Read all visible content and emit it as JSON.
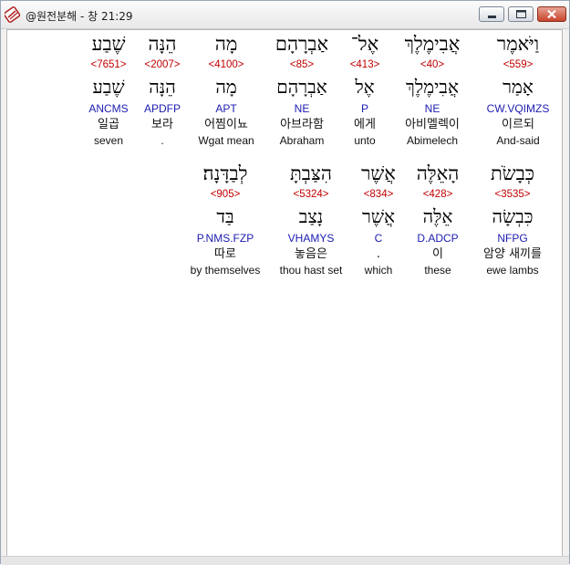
{
  "window": {
    "title": "@원전분해 - 창 21:29"
  },
  "verse": {
    "line1": [
      {
        "hebrew": "וַיֹּאמֶר",
        "strong": "<559>",
        "lemma": "אָמַר",
        "morph": "CW.VQIMZS",
        "korean": "이르되",
        "english": "And-said"
      },
      {
        "hebrew": "אֲבִימֶלֶךְ",
        "strong": "<40>",
        "lemma": "אֲבִימֶלֶךְ",
        "morph": "NE",
        "korean": "아비멜렉이",
        "english": "Abimelech"
      },
      {
        "hebrew": "אֶל־",
        "strong": "<413>",
        "lemma": "אֶל",
        "morph": "P",
        "korean": "에게",
        "english": "unto"
      },
      {
        "hebrew": "אַבְרָהָם",
        "strong": "<85>",
        "lemma": "אַבְרָהָם",
        "morph": "NE",
        "korean": "아브라함",
        "english": "Abraham"
      },
      {
        "hebrew": "מָה",
        "strong": "<4100>",
        "lemma": "מָה",
        "morph": "APT",
        "korean": "어찜이뇨",
        "english": "Wgat mean"
      },
      {
        "hebrew": "הֵנָּה",
        "strong": "<2007>",
        "lemma": "הֵנָּה",
        "morph": "APDFP",
        "korean": "보라",
        "english": "."
      },
      {
        "hebrew": "שֶׁבַע",
        "strong": "<7651>",
        "lemma": "שֶׁבַע",
        "morph": "ANCMS",
        "korean": "일곱",
        "english": "seven"
      }
    ],
    "line2": [
      {
        "hebrew": "כְּבָשֹׂת",
        "strong": "<3535>",
        "lemma": "כִּבְשָׂה",
        "morph": "NFPG",
        "korean": "암양 새끼를",
        "english": "ewe lambs"
      },
      {
        "hebrew": "הָאֵלֶּה",
        "strong": "<428>",
        "lemma": "אֵלֶּה",
        "morph": "D.ADCP",
        "korean": "이",
        "english": "these"
      },
      {
        "hebrew": "אֲשֶׁר",
        "strong": "<834>",
        "lemma": "אֲשֶׁר",
        "morph": "C",
        "korean": ".",
        "english": "which"
      },
      {
        "hebrew": "הִצַּבְתָּ",
        "strong": "<5324>",
        "lemma": "נָצַב",
        "morph": "VHAMYS",
        "korean": "놓음은",
        "english": "thou hast set"
      },
      {
        "hebrew": "לְבַדָּנָה׃",
        "strong": "<905>",
        "lemma": "בַּד",
        "morph": "P.NMS.FZP",
        "korean": "따로",
        "english": "by themselves"
      }
    ]
  }
}
